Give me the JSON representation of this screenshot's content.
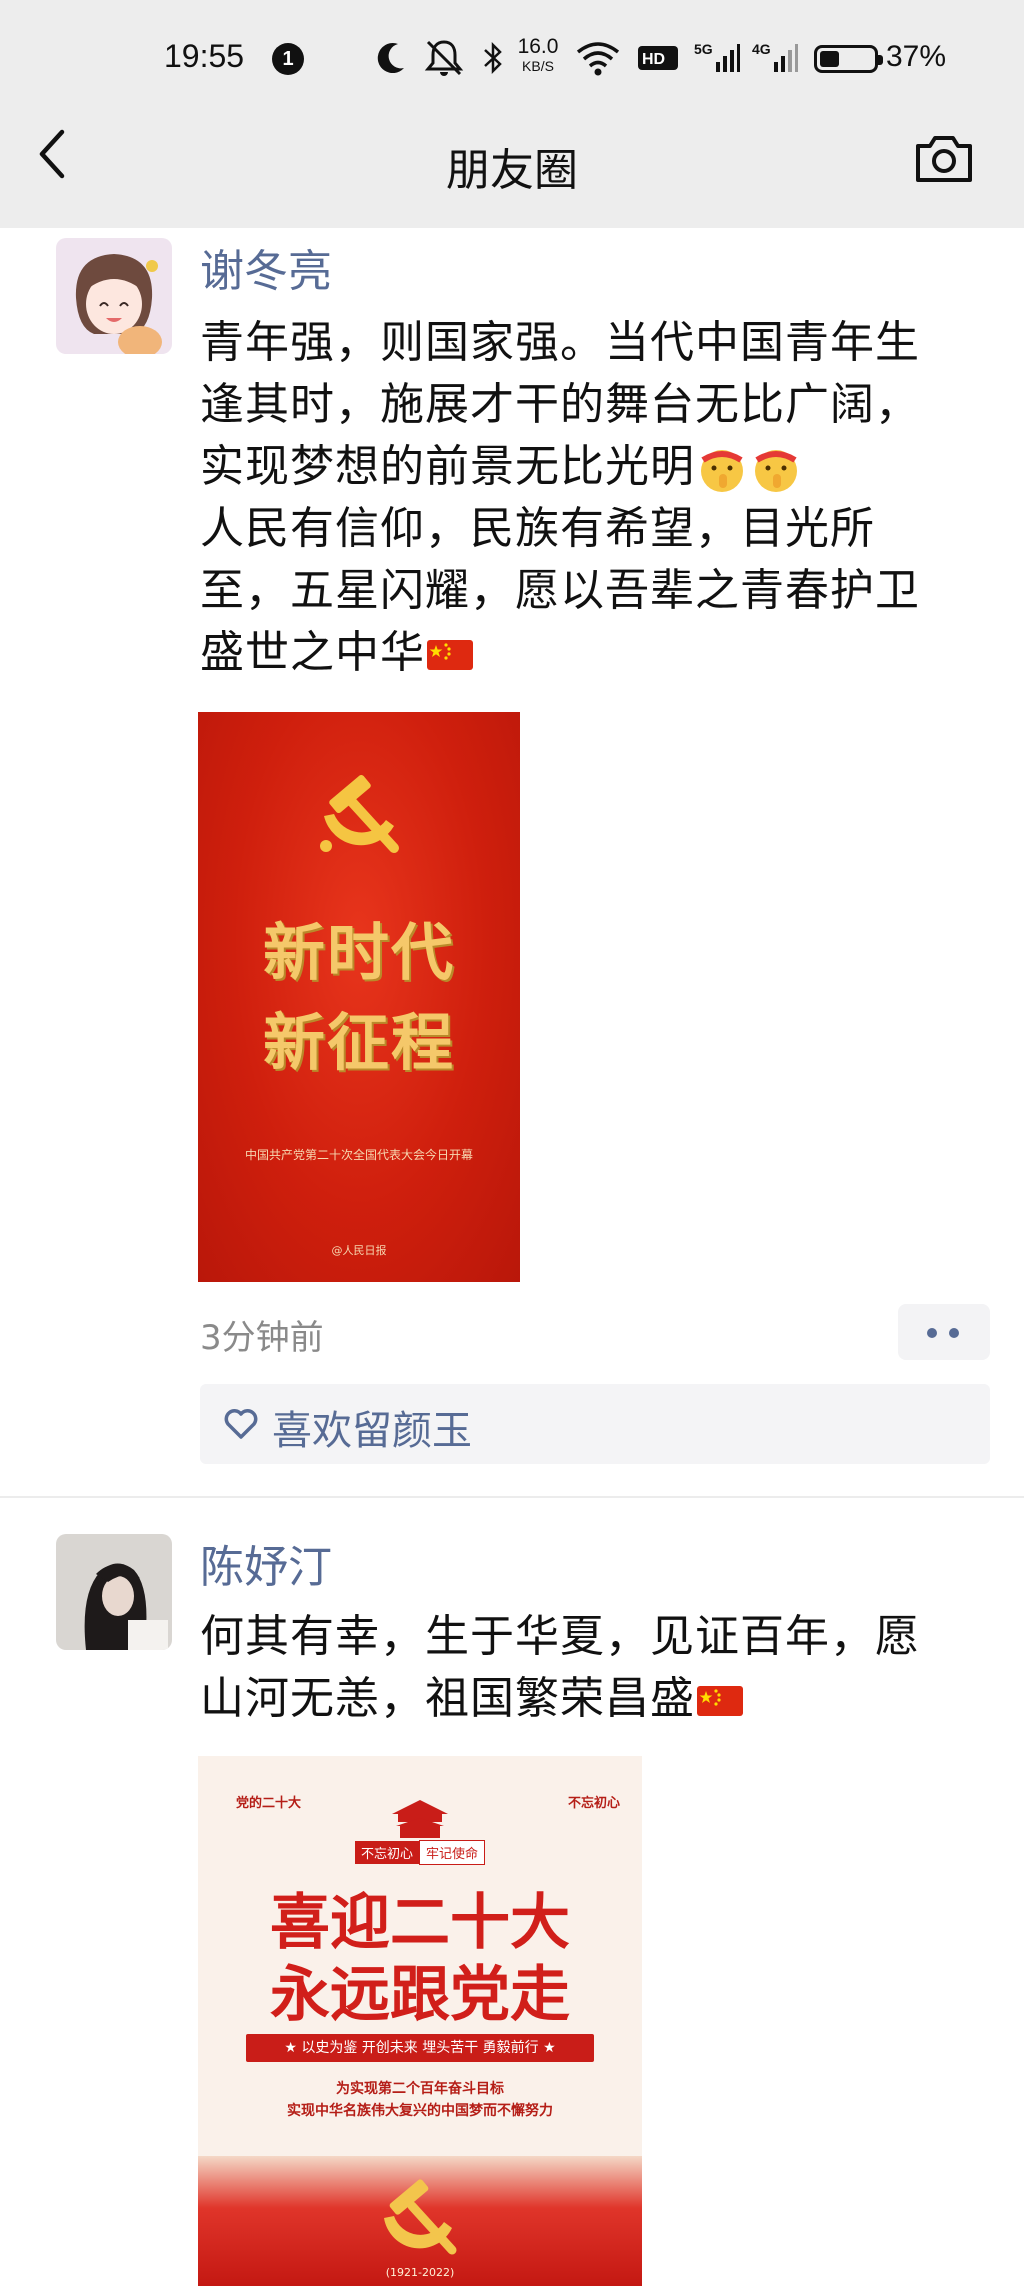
{
  "status_bar": {
    "time": "19:55",
    "notification_count": "1",
    "net_speed_value": "16.0",
    "net_speed_unit": "KB/S",
    "battery_percent": "37%",
    "battery_level": 0.37,
    "icons": [
      "moon-icon",
      "mute-icon",
      "bluetooth-icon",
      "wifi-icon",
      "hd-icon",
      "5g-signal-icon",
      "4g-signal-icon",
      "battery-icon"
    ]
  },
  "nav": {
    "title": "朋友圈",
    "back_icon": "chevron-left-icon",
    "camera_icon": "camera-icon"
  },
  "posts": [
    {
      "author": "谢冬亮",
      "lines": [
        "青年强，则国家强。当代中国青年生",
        "逢其时，施展才干的舞台无比广阔，",
        "实现梦想的前景无比光明",
        "人民有信仰，民族有希望，目光所",
        "至，五星闪耀，愿以吾辈之青春护卫",
        "盛世之中华"
      ],
      "poster": {
        "line1": "新时代",
        "line2": "新征程",
        "subtitle": "中国共产党第二十次全国代表大会今日开幕",
        "logo": "@人民日报"
      },
      "time": "3分钟前",
      "likes": "喜欢留颜玉"
    },
    {
      "author": "陈妤汀",
      "lines": [
        "何其有幸，生于华夏，见证百年，愿",
        "山河无恙，祖国繁荣昌盛"
      ],
      "poster": {
        "top_left": "党的二十大",
        "top_right": "不忘初心",
        "tag_a": "不忘初心",
        "tag_b": "牢记使命",
        "title1": "喜迎二十大",
        "title2": "永远跟党走",
        "ribbon": "★ 以史为鉴 开创未来 埋头苦干 勇毅前行 ★",
        "text1": "为实现第二个百年奋斗目标",
        "text2": "实现中华名族伟大复兴的中国梦而不懈努力",
        "years": "(1921-2022)"
      }
    }
  ],
  "colors": {
    "nav_bg": "#ededed",
    "author": "#576b95",
    "time": "#8a8a8a",
    "poster_red": "#d4220f",
    "gold": "#f5c86a"
  }
}
